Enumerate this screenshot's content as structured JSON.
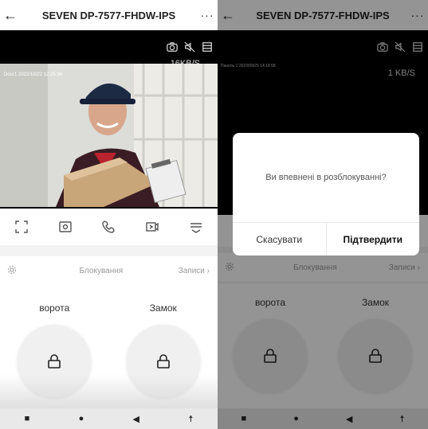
{
  "left": {
    "header": {
      "back_icon": "arrow-left-icon",
      "title": "SEVEN DP-7577-FHDW-IPS",
      "more_label": "···"
    },
    "video": {
      "timestamp": "Door1 2022/10/22 12:25:36",
      "speed": "16KB/S"
    },
    "tabs": {
      "lock_label": "Блокування",
      "records_label": "Записи ›"
    },
    "locks": [
      {
        "label": "ворота"
      },
      {
        "label": "Замок"
      }
    ],
    "navbar": {
      "square": "■",
      "circle": "●",
      "back": "◀",
      "person": "☨"
    }
  },
  "right": {
    "header": {
      "back_icon": "arrow-left-icon",
      "title": "SEVEN DP-7577-FHDW-IPS",
      "more_label": "···"
    },
    "video": {
      "timestamp": "Панель 1 2023/09/25 14:18:58",
      "speed": "1 KB/S"
    },
    "tabs": {
      "lock_label": "Блокування",
      "records_label": "Записи ›"
    },
    "locks": [
      {
        "label": "ворота"
      },
      {
        "label": "Замок"
      }
    ],
    "dialog": {
      "message": "Ви впевнені в розблокуванні?",
      "cancel_label": "Скасувати",
      "confirm_label": "Підтвердити"
    },
    "navbar": {
      "square": "■",
      "circle": "●",
      "back": "◀",
      "person": "☨"
    }
  }
}
